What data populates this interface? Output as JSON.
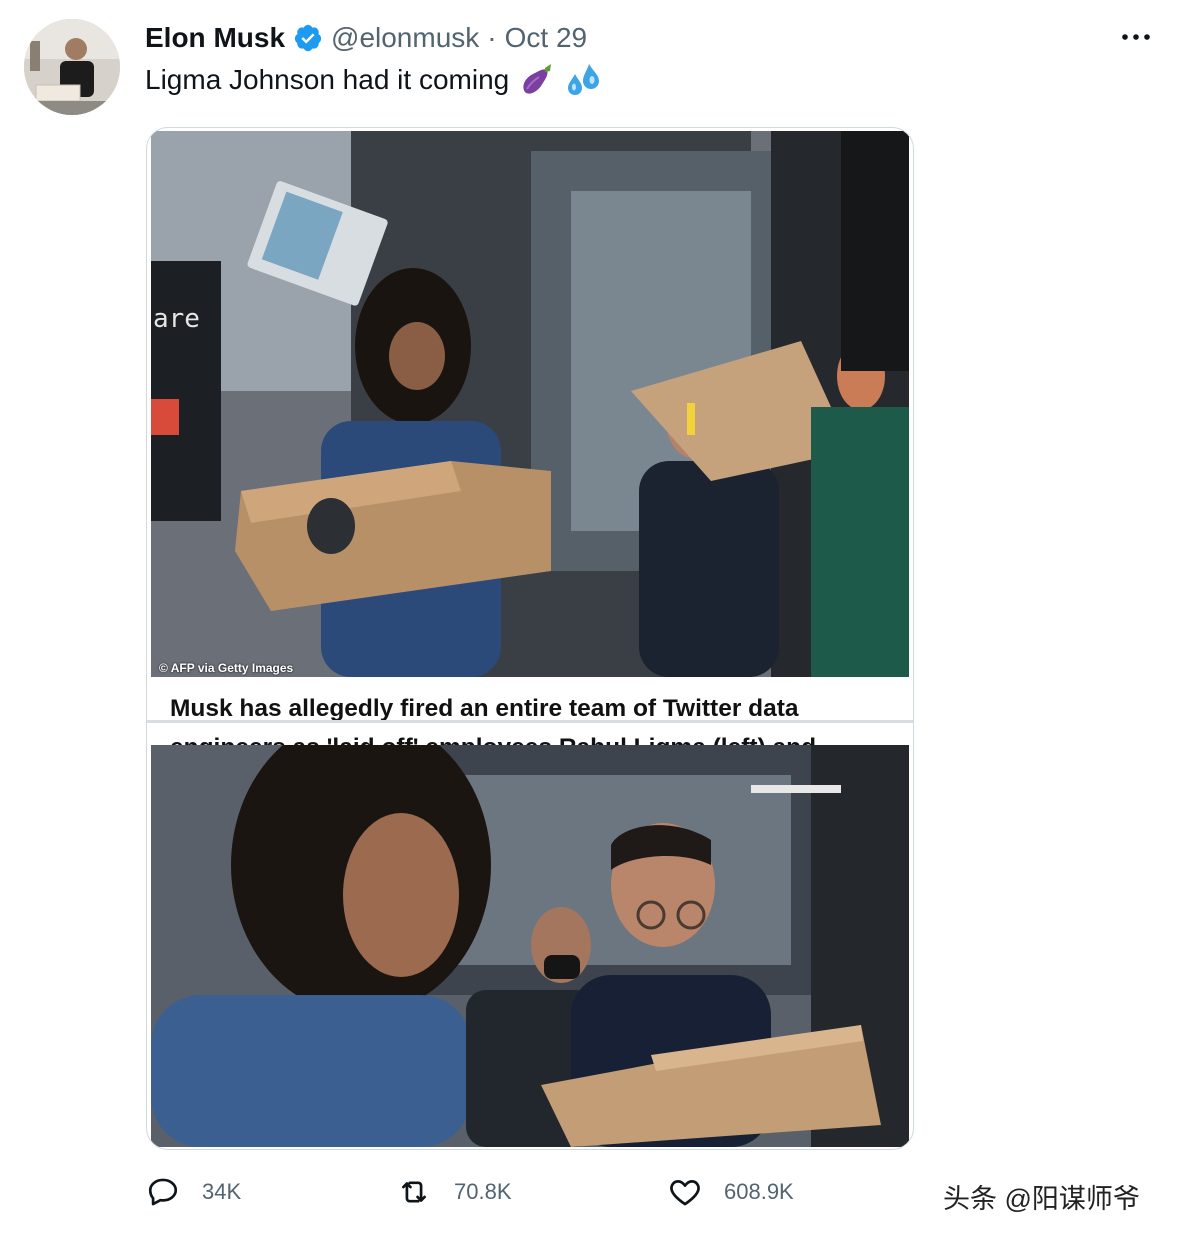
{
  "tweet": {
    "author_name": "Elon Musk",
    "handle": "@elonmusk",
    "separator": "·",
    "date": "Oct 29",
    "text": "Ligma Johnson had it coming",
    "emojis": [
      "eggplant-icon",
      "sweat-droplets-icon"
    ]
  },
  "media": {
    "photo_credit": "© AFP via Getty Images",
    "storefront_sign": "are",
    "caption": "Musk has allegedly fired an entire team of Twitter data engineers as 'laid off' employees Rahul Ligma (left) and Daniel Johnson (right) are pictured walking out of the San Francisco office on Friday afternoon"
  },
  "actions": {
    "replies": "34K",
    "retweets": "70.8K",
    "likes": "608.9K"
  },
  "watermark": "头条 @阳谋师爷",
  "colors": {
    "verified_blue": "#1d9bf0",
    "secondary_text": "#536471"
  }
}
